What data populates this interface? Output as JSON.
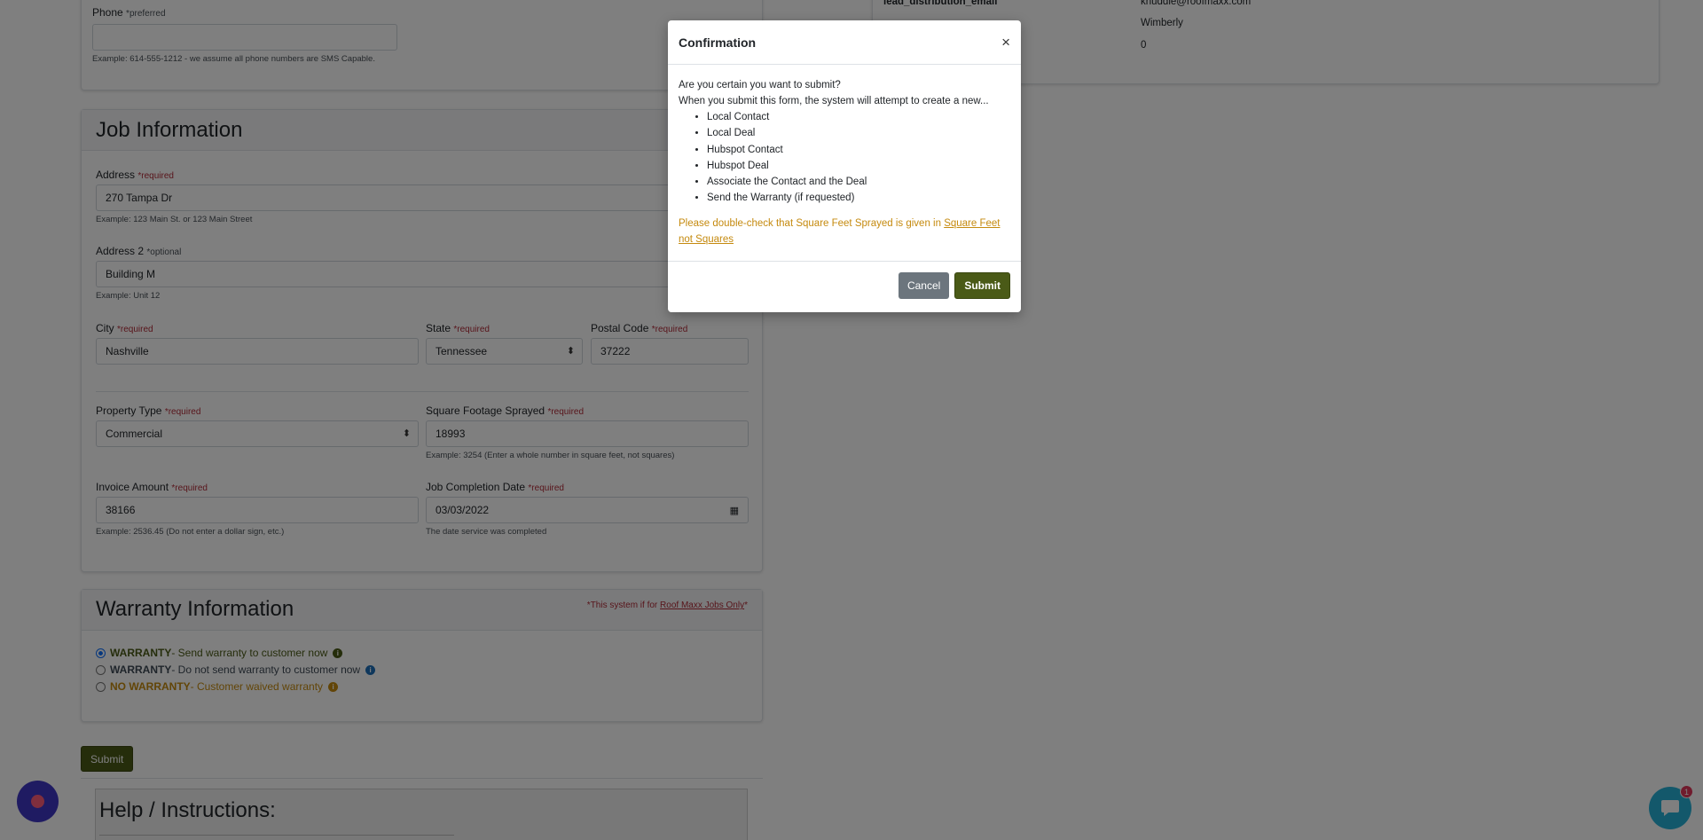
{
  "contact_card": {
    "phone_label": "Phone",
    "phone_tag": "*preferred",
    "phone_value": "",
    "phone_help": "Example: 614-555-1212 - we assume all phone numbers are SMS Capable."
  },
  "side_panel": {
    "rows": [
      {
        "key": "lead_distribution_email",
        "value": "knuddle@roofmaxx.com"
      },
      {
        "key": "",
        "value": "Wimberly"
      },
      {
        "key": "",
        "value": "0"
      }
    ]
  },
  "job": {
    "title": "Job Information",
    "address_label": "Address",
    "address_tag": "*required",
    "address_value": "270 Tampa Dr",
    "address_help": "Example: 123 Main St. or 123 Main Street",
    "address2_label": "Address 2",
    "address2_tag": "*optional",
    "address2_value": "Building M",
    "address2_help": "Example: Unit 12",
    "city_label": "City",
    "city_tag": "*required",
    "city_value": "Nashville",
    "state_label": "State",
    "state_tag": "*required",
    "state_value": "Tennessee",
    "postal_label": "Postal Code",
    "postal_tag": "*required",
    "postal_value": "37222",
    "property_label": "Property Type",
    "property_tag": "*required",
    "property_value": "Commercial",
    "sqft_label": "Square Footage Sprayed",
    "sqft_tag": "*required",
    "sqft_value": "18993",
    "sqft_help": "Example: 3254 (Enter a whole number in square feet, not squares)",
    "invoice_label": "Invoice Amount",
    "invoice_tag": "*required",
    "invoice_value": "38166",
    "invoice_help": "Example: 2536.45 (Do not enter a dollar sign, etc.)",
    "date_label": "Job Completion Date",
    "date_tag": "*required",
    "date_value": "03/03/2022",
    "date_help": "The date service was completed"
  },
  "warranty": {
    "title": "Warranty Information",
    "note_prefix": "*This system if for ",
    "note_link": "Roof Maxx Jobs Only",
    "note_suffix": "*",
    "options": [
      {
        "strong": "WARRANTY",
        "text": " - Send warranty to customer now",
        "selected": true
      },
      {
        "strong": "WARRANTY",
        "text": " - Do not send warranty to customer now",
        "selected": false
      },
      {
        "strong": "NO WARRANTY",
        "text": " - Customer waived warranty",
        "selected": false
      }
    ]
  },
  "page_submit_label": "Submit",
  "help": {
    "title": "Help / Instructions:"
  },
  "modal": {
    "title": "Confirmation",
    "close": "×",
    "question": "Are you certain you want to submit?",
    "intro": "When you submit this form, the system will attempt to create a new...",
    "items": [
      "Local Contact",
      "Local Deal",
      "Hubspot Contact",
      "Hubspot Deal",
      "Associate the Contact and the Deal",
      "Send the Warranty (if requested)"
    ],
    "warning_prefix": "Please double-check that Square Feet Sprayed is given in ",
    "warning_link": "Square Feet not Squares",
    "cancel_label": "Cancel",
    "submit_label": "Submit"
  },
  "chat_badge": "1",
  "colors": {
    "required": "#b02a37",
    "brand_green": "#4a5a17",
    "warning": "#c58a0f",
    "overlay": "rgba(0,0,0,0.5)"
  }
}
